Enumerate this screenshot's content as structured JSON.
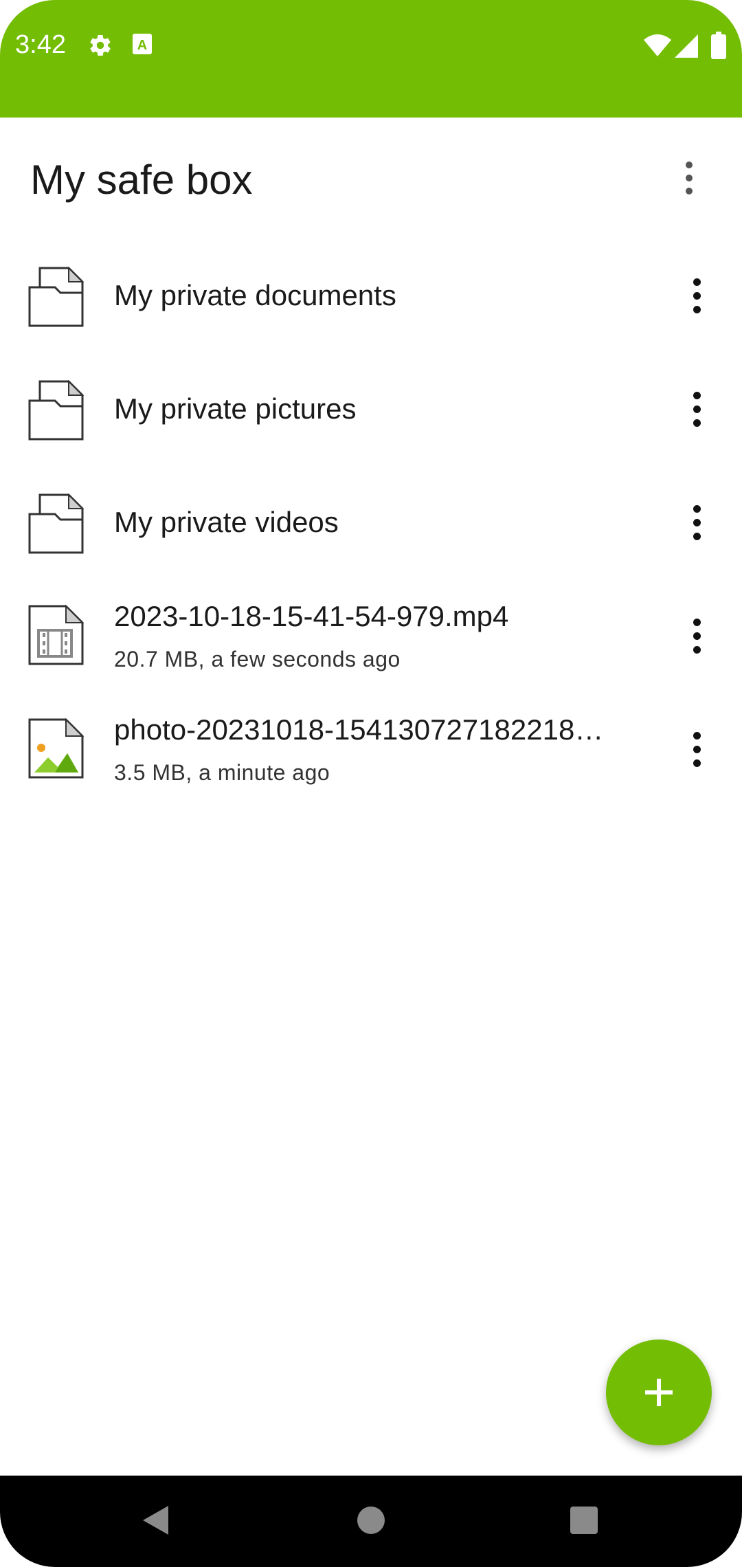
{
  "status_bar": {
    "time": "3:42",
    "icons": [
      "gear-icon",
      "keyboard-a-icon",
      "wifi-icon",
      "signal-icon",
      "battery-icon"
    ],
    "background": "#74bd05"
  },
  "app_bar": {
    "title": "My safe box",
    "menu_icon": "more-vert-icon"
  },
  "items": [
    {
      "type": "folder",
      "title": "My private documents",
      "subtitle": "",
      "icon": "folder-icon"
    },
    {
      "type": "folder",
      "title": "My private pictures",
      "subtitle": "",
      "icon": "folder-icon"
    },
    {
      "type": "folder",
      "title": "My private videos",
      "subtitle": "",
      "icon": "folder-icon"
    },
    {
      "type": "video",
      "title": "2023-10-18-15-41-54-979.mp4",
      "subtitle": "20.7 MB, a few seconds ago",
      "icon": "video-file-icon"
    },
    {
      "type": "image",
      "title": "photo-20231018-154130727182218…",
      "subtitle": "3.5 MB, a minute ago",
      "icon": "image-file-icon"
    }
  ],
  "fab": {
    "icon": "plus-icon",
    "color": "#74bd05"
  },
  "nav_bar": {
    "icons": [
      "back-icon",
      "home-icon",
      "recents-icon"
    ]
  }
}
